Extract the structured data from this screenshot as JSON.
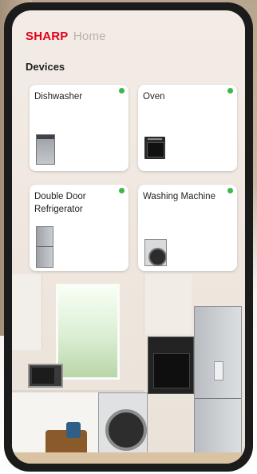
{
  "header": {
    "brand": "SHARP",
    "app_name": "Home"
  },
  "devices_section": {
    "title": "Devices",
    "items": [
      {
        "name": "Dishwasher",
        "status": "online",
        "icon": "dishwasher-icon"
      },
      {
        "name": "Oven",
        "status": "online",
        "icon": "oven-icon"
      },
      {
        "name": "Double Door Refrigerator",
        "status": "online",
        "icon": "refrigerator-icon"
      },
      {
        "name": "Washing Machine",
        "status": "online",
        "icon": "washing-machine-icon"
      }
    ]
  },
  "colors": {
    "brand": "#e4001b",
    "status_online": "#3bb84a",
    "card_background": "#ffffff"
  }
}
